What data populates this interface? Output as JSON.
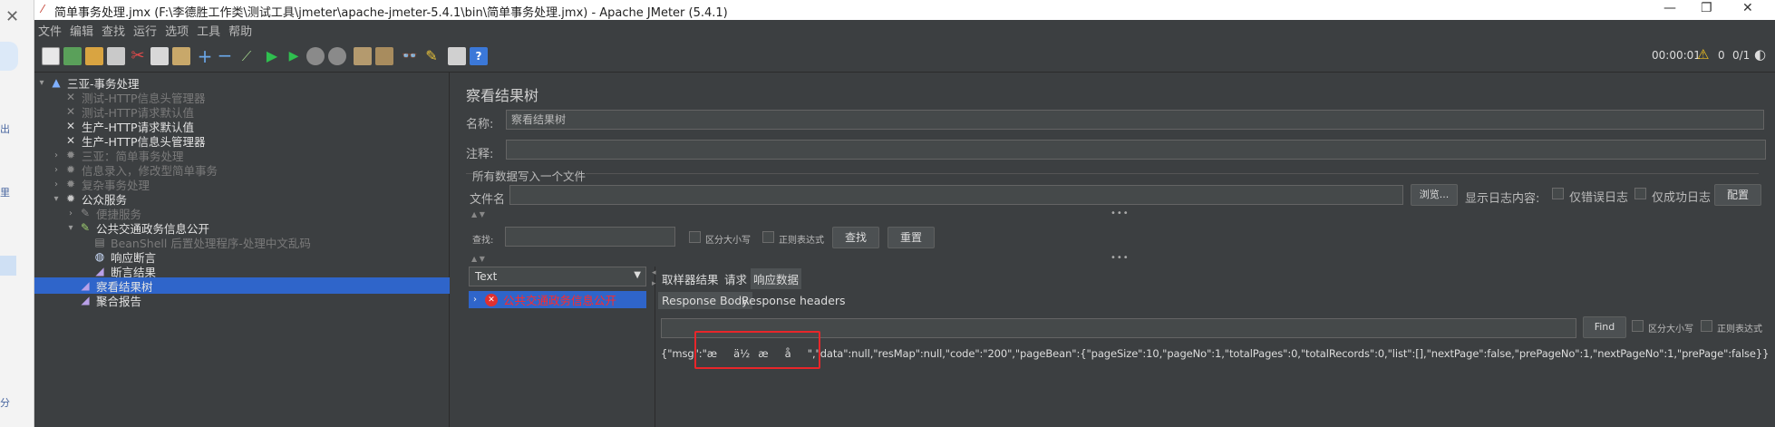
{
  "window": {
    "title": "简单事务处理.jmx (F:\\李德胜工作类\\测试工具\\jmeter\\apache-jmeter-5.4.1\\bin\\简单事务处理.jmx) - Apache JMeter (5.4.1)"
  },
  "left_strip": {
    "chars": [
      "出",
      "里",
      "分"
    ]
  },
  "menu": [
    "文件",
    "编辑",
    "查找",
    "运行",
    "选项",
    "工具",
    "帮助"
  ],
  "toolbar": {
    "timer": "00:00:01",
    "warn_count": "0",
    "threads": "0/1"
  },
  "tree": [
    {
      "label": "三亚-事务处理",
      "indent": 0,
      "arrow": "▾",
      "icon": "testplan-icon",
      "state": "en"
    },
    {
      "label": "测试-HTTP信息头管理器",
      "indent": 1,
      "arrow": "",
      "icon": "wrench-icon",
      "state": "dis"
    },
    {
      "label": "测试-HTTP请求默认值",
      "indent": 1,
      "arrow": "",
      "icon": "wrench-icon",
      "state": "dis"
    },
    {
      "label": "生产-HTTP请求默认值",
      "indent": 1,
      "arrow": "",
      "icon": "wrench-icon",
      "state": "en"
    },
    {
      "label": "生产-HTTP信息头管理器",
      "indent": 1,
      "arrow": "",
      "icon": "wrench-icon",
      "state": "en"
    },
    {
      "label": "三亚：简单事务处理",
      "indent": 1,
      "arrow": "›",
      "icon": "gear-icon",
      "state": "dis"
    },
    {
      "label": "信息录入，修改型简单事务",
      "indent": 1,
      "arrow": "›",
      "icon": "gear-icon",
      "state": "dis"
    },
    {
      "label": "复杂事务处理",
      "indent": 1,
      "arrow": "›",
      "icon": "gear-icon",
      "state": "dis"
    },
    {
      "label": "公众服务",
      "indent": 1,
      "arrow": "▾",
      "icon": "gear-icon",
      "state": "en"
    },
    {
      "label": "便捷服务",
      "indent": 2,
      "arrow": "›",
      "icon": "pen-icon",
      "state": "dis"
    },
    {
      "label": "公共交通政务信息公开",
      "indent": 2,
      "arrow": "▾",
      "icon": "pen-icon",
      "state": "en"
    },
    {
      "label": "BeanShell 后置处理程序-处理中文乱码",
      "indent": 3,
      "arrow": "",
      "icon": "script-icon",
      "state": "dis"
    },
    {
      "label": "响应断言",
      "indent": 3,
      "arrow": "",
      "icon": "magnifier-icon",
      "state": "en"
    },
    {
      "label": "断言结果",
      "indent": 3,
      "arrow": "",
      "icon": "chart-icon",
      "state": "en"
    },
    {
      "label": "察看结果树",
      "indent": 2,
      "arrow": "",
      "icon": "chart-icon",
      "state": "sel"
    },
    {
      "label": "聚合报告",
      "indent": 2,
      "arrow": "",
      "icon": "chart-icon",
      "state": "en"
    }
  ],
  "panel": {
    "title": "察看结果树",
    "name_label": "名称:",
    "name_value": "察看结果树",
    "comment_label": "注释:",
    "file_section": "所有数据写入一个文件",
    "filename_label": "文件名",
    "browse": "浏览...",
    "log_label": "显示日志内容:",
    "errors_only": "仅错误日志",
    "success_only": "仅成功日志",
    "configure": "配置",
    "search_label": "查找:",
    "case_sensitive": "区分大小写",
    "regex": "正则表达式",
    "find_btn": "查找",
    "reset_btn": "重置"
  },
  "results": {
    "renderer": "Text",
    "sample": "公共交通政务信息公开",
    "tabs": [
      "取样器结果",
      "请求",
      "响应数据"
    ],
    "subtabs": [
      "Response Body",
      "Response headers"
    ],
    "find": "Find",
    "case_sensitive": "区分大小写",
    "regex": "正则表达式",
    "body": "{\"msg\":\"æä½æå\",\"data\":null,\"resMap\":null,\"code\":\"200\",\"pageBean\":{\"pageSize\":10,\"pageNo\":1,\"totalPages\":0,\"totalRecords\":0,\"list\":[],\"nextPage\":false,\"prePageNo\":1,\"nextPageNo\":1,\"prePage\":false}}"
  }
}
